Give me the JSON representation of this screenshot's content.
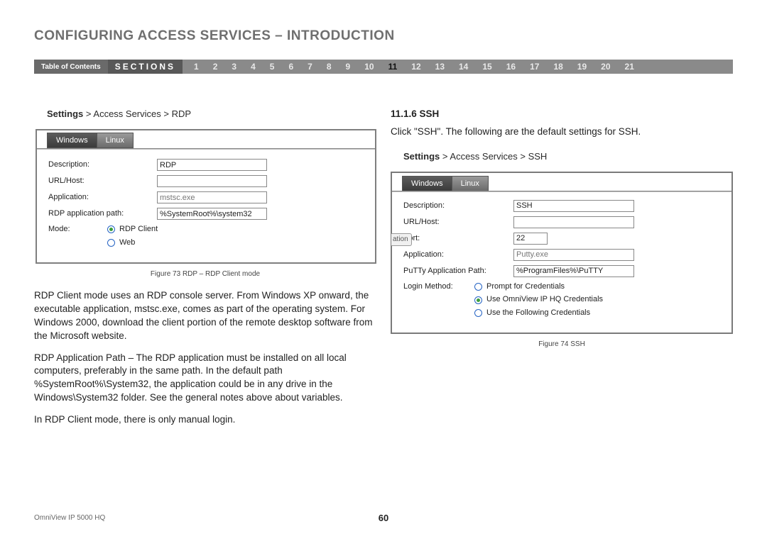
{
  "header": {
    "title": "CONFIGURING ACCESS SERVICES – INTRODUCTION"
  },
  "nav": {
    "toc": "Table of Contents",
    "sections_label": "SECTIONS",
    "numbers": [
      "1",
      "2",
      "3",
      "4",
      "5",
      "6",
      "7",
      "8",
      "9",
      "10",
      "11",
      "12",
      "13",
      "14",
      "15",
      "16",
      "17",
      "18",
      "19",
      "20",
      "21"
    ],
    "active": "11"
  },
  "left": {
    "breadcrumb_bold": "Settings",
    "breadcrumb_rest": " > Access Services > RDP",
    "tabs": {
      "a": "Windows",
      "b": "Linux"
    },
    "rows": {
      "description_label": "Description:",
      "description_value": "RDP",
      "url_label": "URL/Host:",
      "url_value": "",
      "app_label": "Application:",
      "app_value": "mstsc.exe",
      "path_label": "RDP application path:",
      "path_value": "%SystemRoot%\\system32",
      "mode_label": "Mode:",
      "mode_opt1": "RDP Client",
      "mode_opt2": "Web"
    },
    "caption": "Figure 73 RDP – RDP Client mode",
    "paras": {
      "p1": "RDP Client mode uses an RDP console server. From Windows XP onward, the executable application, mstsc.exe, comes as part of the operating system. For Windows 2000, download the client portion of the remote desktop software from the Microsoft website.",
      "p2": "RDP Application Path – The RDP application must be installed on all local computers, preferably in the same path. In the default path %SystemRoot%\\System32, the application could be in any drive in the Windows\\System32 folder. See the general notes above about variables.",
      "p3": "In RDP Client mode, there is only manual login."
    }
  },
  "right": {
    "heading": "11.1.6 SSH",
    "intro": "Click \"SSH\". The following are the default settings for SSH.",
    "breadcrumb_bold": "Settings",
    "breadcrumb_rest": " > Access Services > SSH",
    "tabs": {
      "a": "Windows",
      "b": "Linux"
    },
    "fragment": "ation",
    "rows": {
      "description_label": "Description:",
      "description_value": "SSH",
      "url_label": "URL/Host:",
      "url_value": "",
      "port_label": "Port:",
      "port_value": "22",
      "app_label": "Application:",
      "app_value": "Putty.exe",
      "path_label": "PuTTy Application Path:",
      "path_value": "%ProgramFiles%\\PuTTY",
      "login_label": "Login Method:",
      "login_opt1": "Prompt for Credentials",
      "login_opt2": "Use OmniView IP HQ Credentials",
      "login_opt3": "Use the Following Credentials"
    },
    "caption": "Figure 74 SSH"
  },
  "footer": {
    "product": "OmniView IP 5000 HQ",
    "page": "60"
  }
}
